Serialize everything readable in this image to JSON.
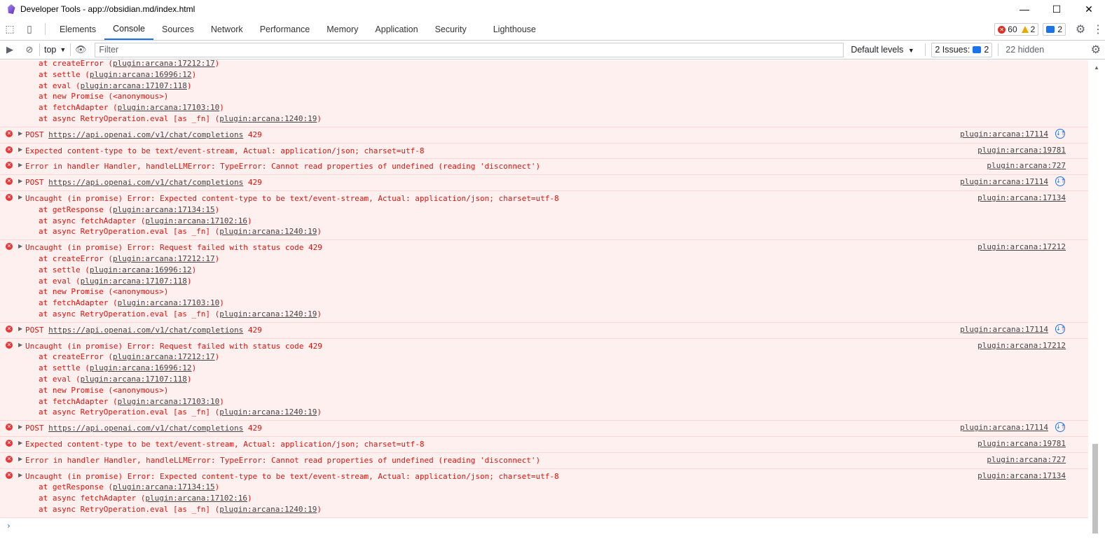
{
  "window": {
    "title": "Developer Tools - app://obsidian.md/index.html",
    "min": "—",
    "max": "☐",
    "close": "✕"
  },
  "tabs": [
    "Elements",
    "Console",
    "Sources",
    "Network",
    "Performance",
    "Memory",
    "Application",
    "Security",
    "Lighthouse"
  ],
  "active_tab": "Console",
  "counts": {
    "errors": "60",
    "warnings": "2",
    "messages": "2"
  },
  "toolbar": {
    "context": "top",
    "filter_placeholder": "Filter",
    "levels": "Default levels",
    "issues_label": "2 Issues:",
    "issues_count": "2",
    "hidden": "22 hidden"
  },
  "colors": {
    "error_bg": "#fff0f0",
    "error_text": "#e3120b",
    "accent": "#1a73e8"
  },
  "entries": [
    {
      "type": "stack-tail",
      "stack": [
        "at createError (|plugin:arcana:17212:17|)",
        "at settle (|plugin:arcana:16996:12|)",
        "at eval (|plugin:arcana:17107:118|)",
        "at new Promise (<anonymous>)",
        "at fetchAdapter (|plugin:arcana:17103:10|)",
        "at async RetryOperation.eval [as _fn] (|plugin:arcana:1240:19|)"
      ]
    },
    {
      "type": "network",
      "msg": "POST |https://api.openai.com/v1/chat/completions| 429",
      "src": "plugin:arcana:17114"
    },
    {
      "type": "error",
      "msg": "Expected content-type to be text/event-stream, Actual: application/json; charset=utf-8",
      "src": "plugin:arcana:19781"
    },
    {
      "type": "error",
      "msg": "Error in handler Handler, handleLLMError: TypeError: Cannot read properties of undefined (reading 'disconnect')",
      "src": "plugin:arcana:727"
    },
    {
      "type": "network",
      "msg": "POST |https://api.openai.com/v1/chat/completions| 429",
      "src": "plugin:arcana:17114"
    },
    {
      "type": "error",
      "msg": "Uncaught (in promise) Error: Expected content-type to be text/event-stream, Actual: application/json; charset=utf-8",
      "src": "plugin:arcana:17134",
      "stack": [
        "at getResponse (|plugin:arcana:17134:15|)",
        "at async fetchAdapter (|plugin:arcana:17102:16|)",
        "at async RetryOperation.eval [as _fn] (|plugin:arcana:1240:19|)"
      ]
    },
    {
      "type": "error",
      "msg": "Uncaught (in promise) Error: Request failed with status code 429",
      "src": "plugin:arcana:17212",
      "stack": [
        "at createError (|plugin:arcana:17212:17|)",
        "at settle (|plugin:arcana:16996:12|)",
        "at eval (|plugin:arcana:17107:118|)",
        "at new Promise (<anonymous>)",
        "at fetchAdapter (|plugin:arcana:17103:10|)",
        "at async RetryOperation.eval [as _fn] (|plugin:arcana:1240:19|)"
      ]
    },
    {
      "type": "network",
      "msg": "POST |https://api.openai.com/v1/chat/completions| 429",
      "src": "plugin:arcana:17114"
    },
    {
      "type": "error",
      "msg": "Uncaught (in promise) Error: Request failed with status code 429",
      "src": "plugin:arcana:17212",
      "stack": [
        "at createError (|plugin:arcana:17212:17|)",
        "at settle (|plugin:arcana:16996:12|)",
        "at eval (|plugin:arcana:17107:118|)",
        "at new Promise (<anonymous>)",
        "at fetchAdapter (|plugin:arcana:17103:10|)",
        "at async RetryOperation.eval [as _fn] (|plugin:arcana:1240:19|)"
      ]
    },
    {
      "type": "network",
      "msg": "POST |https://api.openai.com/v1/chat/completions| 429",
      "src": "plugin:arcana:17114"
    },
    {
      "type": "error",
      "msg": "Expected content-type to be text/event-stream, Actual: application/json; charset=utf-8",
      "src": "plugin:arcana:19781"
    },
    {
      "type": "error",
      "msg": "Error in handler Handler, handleLLMError: TypeError: Cannot read properties of undefined (reading 'disconnect')",
      "src": "plugin:arcana:727"
    },
    {
      "type": "error",
      "msg": "Uncaught (in promise) Error: Expected content-type to be text/event-stream, Actual: application/json; charset=utf-8",
      "src": "plugin:arcana:17134",
      "stack": [
        "at getResponse (|plugin:arcana:17134:15|)",
        "at async fetchAdapter (|plugin:arcana:17102:16|)",
        "at async RetryOperation.eval [as _fn] (|plugin:arcana:1240:19|)"
      ]
    }
  ]
}
